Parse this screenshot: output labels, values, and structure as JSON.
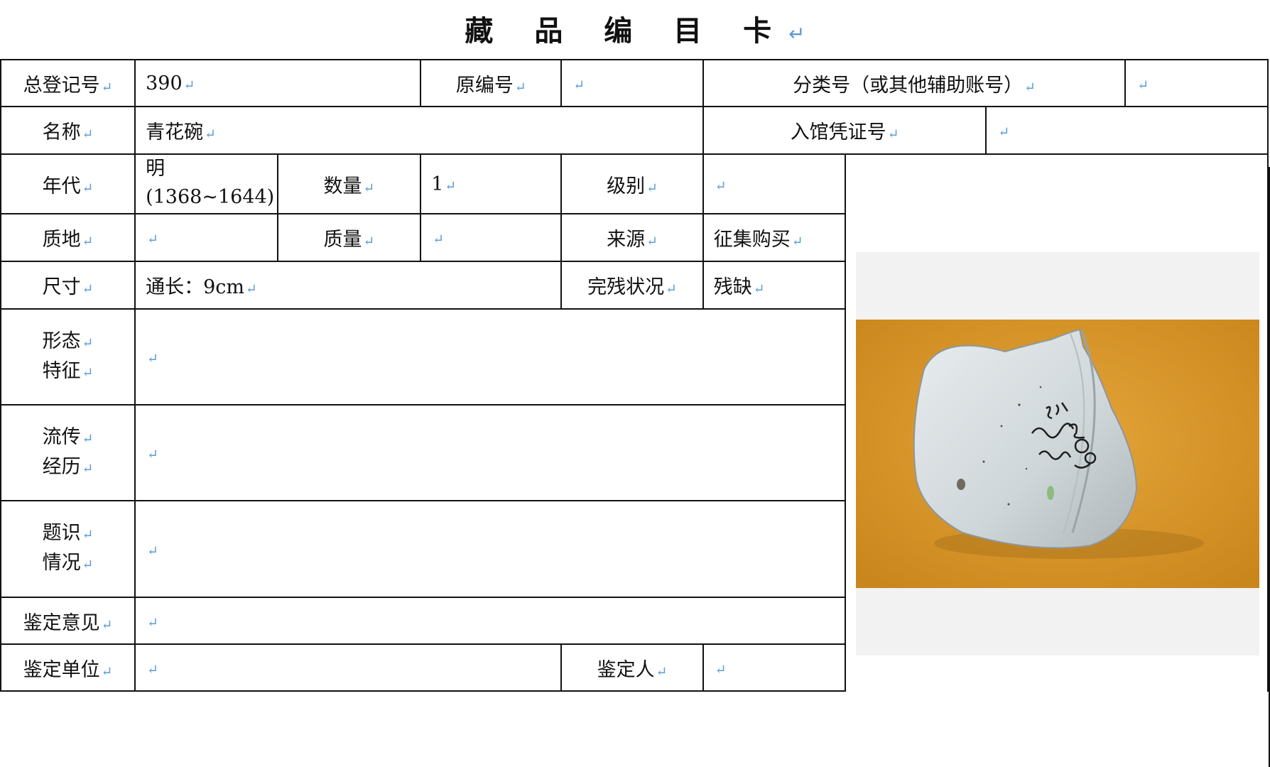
{
  "title": "藏 品 编 目 卡",
  "para_mark": "↵",
  "labels": {
    "total_reg_no": "总登记号",
    "original_no": "原编号",
    "class_no": "分类号（或其他辅助账号）",
    "name": "名称",
    "entry_voucher_no": "入馆凭证号",
    "era": "年代",
    "quantity": "数量",
    "grade": "级别",
    "texture": "质地",
    "weight": "质量",
    "source": "来源",
    "size": "尺寸",
    "condition": "完残状况",
    "morphology_1": "形态",
    "morphology_2": "特征",
    "provenance_1": "流传",
    "provenance_2": "经历",
    "inscription_1": "题识",
    "inscription_2": "情况",
    "appraisal_opinion": "鉴定意见",
    "appraisal_unit": "鉴定单位",
    "appraiser": "鉴定人"
  },
  "values": {
    "total_reg_no": "390",
    "original_no": "",
    "class_no": "",
    "name": "青花碗",
    "entry_voucher_no": "",
    "era_line1": "明",
    "era_line2": "(1368~1644)",
    "quantity": "1",
    "grade": "",
    "texture": "",
    "weight": "",
    "source": "征集购买",
    "size": "通长：9cm",
    "condition": "残缺",
    "morphology": "",
    "provenance": "",
    "inscription": "",
    "appraisal_opinion": "",
    "appraisal_unit": "",
    "appraiser": ""
  },
  "photo": {
    "subject": "blue-and-white porcelain bowl fragment with ink-written catalog number",
    "ink_number": "390",
    "colors": {
      "background": "#d99a2a",
      "porcelain": "#d6dde0",
      "ink": "#1f1f1f",
      "frame": "#f2f2f2"
    }
  }
}
